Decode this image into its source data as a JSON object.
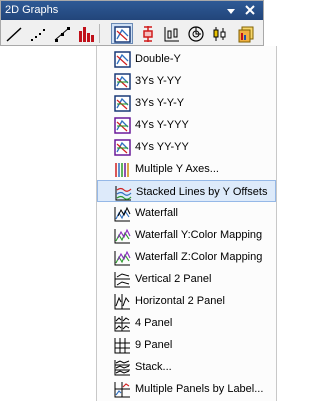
{
  "toolbar": {
    "title": "2D Graphs",
    "buttons": [
      {
        "icon": "line-chart-icon"
      },
      {
        "icon": "scatter-chart-icon"
      },
      {
        "icon": "line-symbol-chart-icon"
      },
      {
        "icon": "column-chart-icon"
      },
      {
        "icon": "multi-axis-chart-icon"
      },
      {
        "icon": "error-bar-chart-icon"
      },
      {
        "icon": "box-chart-icon"
      },
      {
        "icon": "polar-chart-icon"
      },
      {
        "icon": "stock-chart-icon"
      },
      {
        "icon": "template-chart-icon"
      }
    ]
  },
  "menu": {
    "items": [
      {
        "label": "Double-Y"
      },
      {
        "label": "3Ys Y-YY"
      },
      {
        "label": "3Ys Y-Y-Y"
      },
      {
        "label": "4Ys Y-YYY"
      },
      {
        "label": "4Ys YY-YY"
      },
      {
        "label": "Multiple Y Axes..."
      },
      {
        "label": "Stacked Lines by Y Offsets"
      },
      {
        "label": "Waterfall"
      },
      {
        "label": "Waterfall Y:Color Mapping"
      },
      {
        "label": "Waterfall Z:Color Mapping"
      },
      {
        "label": "Vertical 2 Panel"
      },
      {
        "label": "Horizontal 2 Panel"
      },
      {
        "label": "4 Panel"
      },
      {
        "label": "9 Panel"
      },
      {
        "label": "Stack..."
      },
      {
        "label": "Multiple Panels by Label..."
      }
    ],
    "highlighted": "Stacked Lines by Y Offsets"
  }
}
